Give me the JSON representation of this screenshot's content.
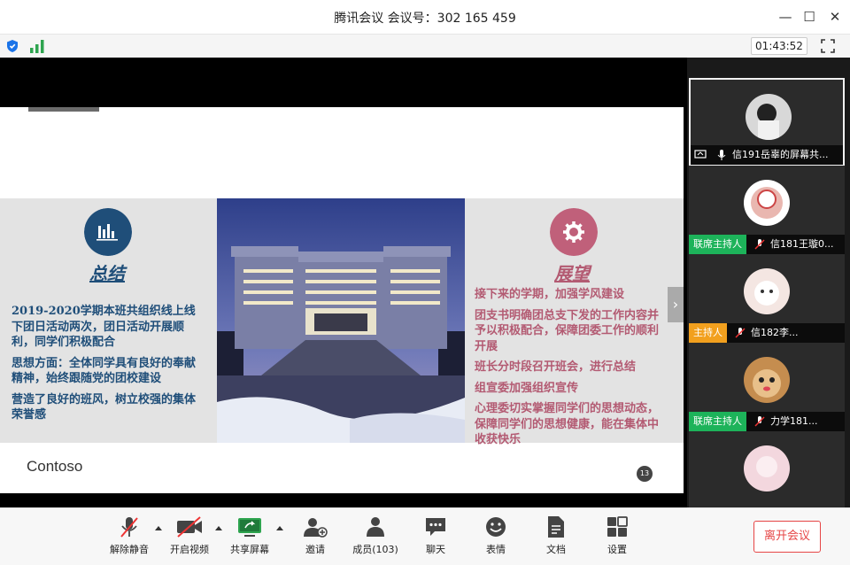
{
  "window": {
    "title": "腾讯会议 会议号：302 165 459"
  },
  "status": {
    "timer": "01:43:52"
  },
  "slide": {
    "left_heading": "总结",
    "left_paragraphs": [
      "2019-2020学期本班共组织线上线下团日活动两次，团日活动开展顺利，同学们积极配合",
      "思想方面：全体同学具有良好的奉献精神，始终跟随党的团校建设",
      "营造了良好的班风，树立校强的集体荣誉感"
    ],
    "right_heading": "展望",
    "right_paragraphs": [
      "接下来的学期，加强学风建设",
      "团支书明确团总支下发的工作内容并予以积极配合，保障团委工作的顺利开展",
      "班长分时段召开班会，进行总结",
      "组宣委加强组织宣传",
      "心理委切实掌握同学们的思想动态，保障同学们的思想健康，能在集体中收获快乐"
    ],
    "logo": "Contoso",
    "page_number": "13",
    "colors": {
      "left_accent": "#1f4e79",
      "right_accent": "#c0607a",
      "left_text": "#1f4e79",
      "right_text": "#b35a72"
    }
  },
  "participants": [
    {
      "name": "信191岳辜的屏幕共...",
      "badge": "",
      "active": true
    },
    {
      "name": "信181王璇0...",
      "badge": "联席主持人",
      "badge_color": "green"
    },
    {
      "name": "信182李...",
      "badge": "主持人",
      "badge_color": "orange"
    },
    {
      "name": "力学181...",
      "badge": "联席主持人",
      "badge_color": "green"
    }
  ],
  "toolbar": {
    "mute": "解除静音",
    "video": "开启视频",
    "share": "共享屏幕",
    "invite": "邀请",
    "members": "成员(103)",
    "chat": "聊天",
    "emoji": "表情",
    "docs": "文档",
    "settings": "设置",
    "leave": "离开会议"
  }
}
